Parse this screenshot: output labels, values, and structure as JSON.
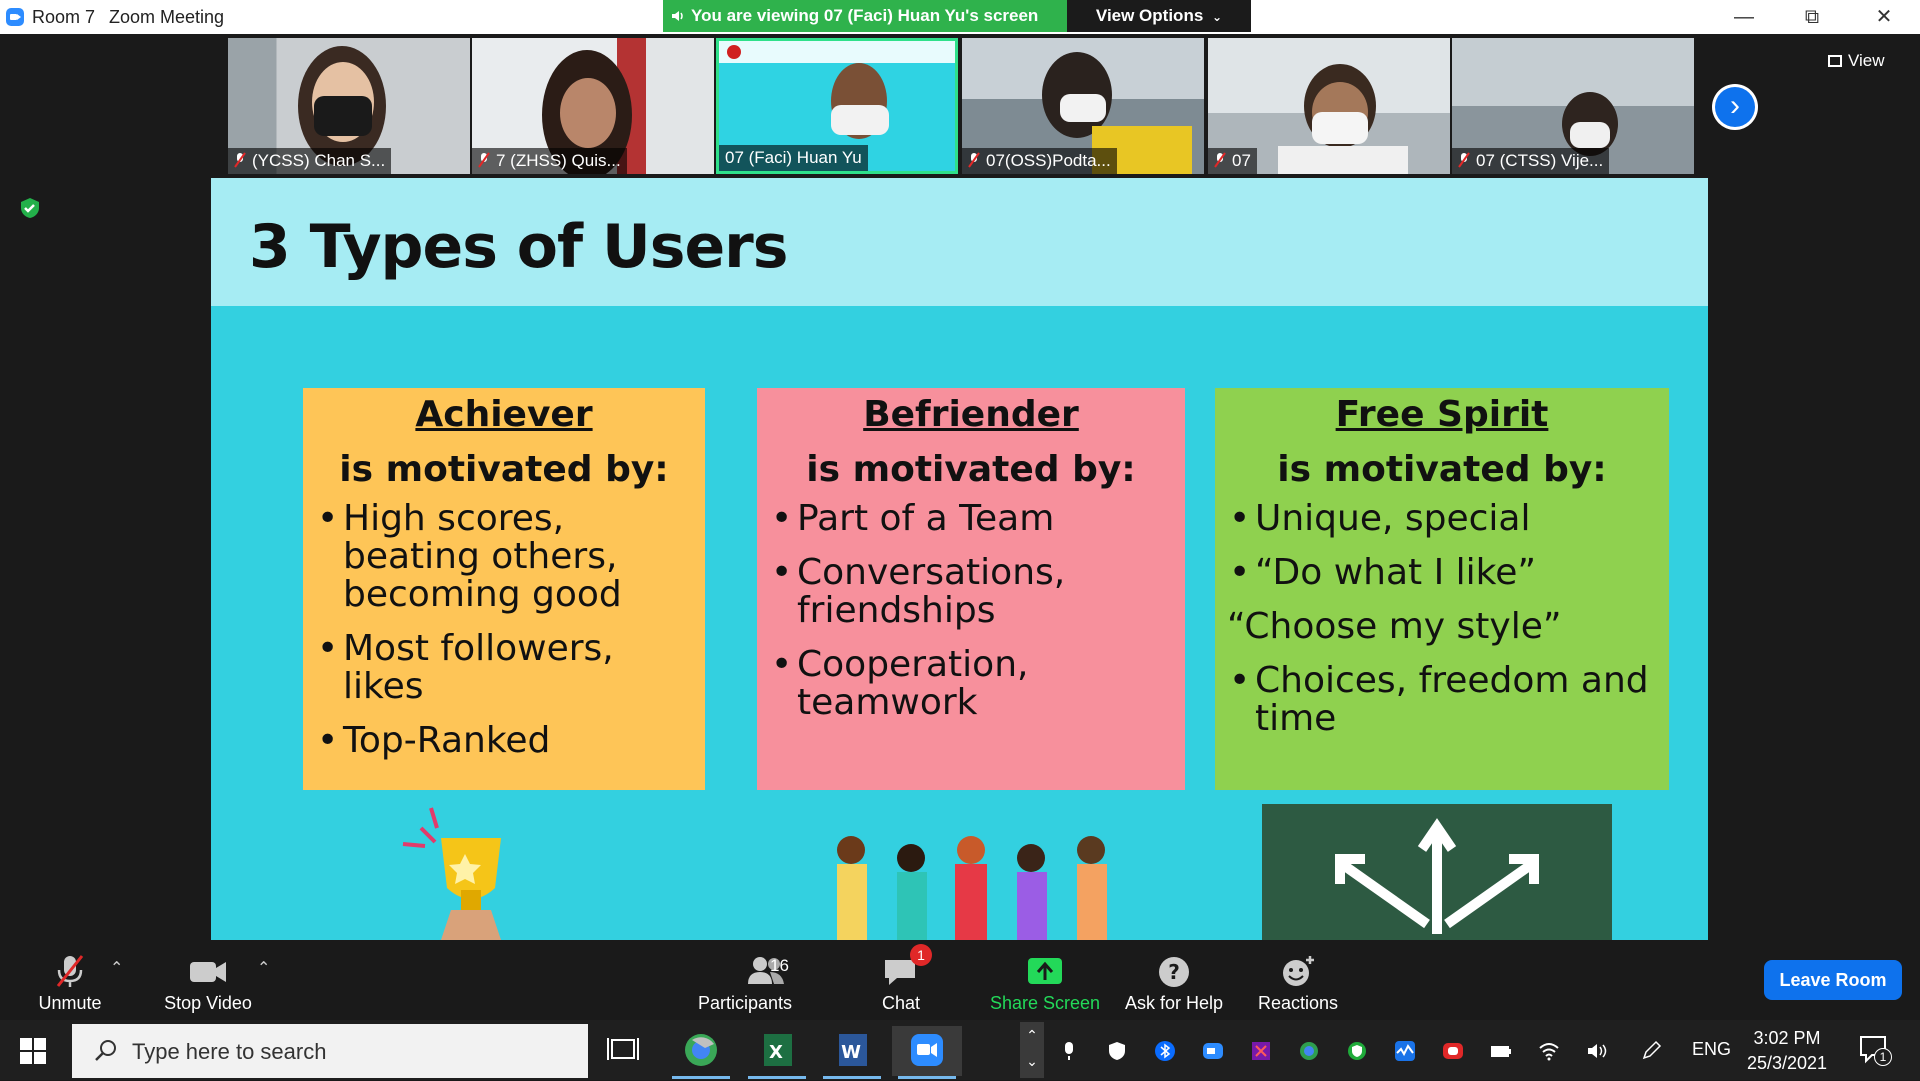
{
  "titlebar": {
    "room": "Room 7",
    "app": "Zoom Meeting",
    "banner": "You are viewing 07 (Faci) Huan Yu's screen",
    "view_options": "View Options",
    "view_options_icon": "chevron-down-icon"
  },
  "thumbnails": [
    {
      "name": "(YCSS) Chan S...",
      "muted": true
    },
    {
      "name": "7 (ZHSS) Quis...",
      "muted": true
    },
    {
      "name": "07 (Faci) Huan Yu",
      "muted": false,
      "active": true
    },
    {
      "name": "07(OSS)Podta...",
      "muted": true
    },
    {
      "name": "07",
      "muted": true
    },
    {
      "name": "07 (CTSS) Vije...",
      "muted": true
    }
  ],
  "view_button": "View",
  "slide": {
    "title": "3 Types of Users",
    "cards": [
      {
        "heading": "Achiever",
        "sub": "is motivated by:",
        "items": [
          "High scores, beating others, becoming good",
          "Most followers, likes",
          "Top-Ranked"
        ]
      },
      {
        "heading": "Befriender",
        "sub": "is motivated by:",
        "items": [
          "Part of a Team",
          "Conversations, friendships",
          "Cooperation, teamwork"
        ]
      },
      {
        "heading": "Free Spirit",
        "sub": "is motivated by:",
        "items": [
          "Unique, special",
          "“Do what I like”",
          "“Choose my style”",
          "Choices, freedom and time"
        ]
      }
    ]
  },
  "toolbar": {
    "unmute": "Unmute",
    "stop_video": "Stop Video",
    "participants": "Participants",
    "participants_count": "16",
    "chat": "Chat",
    "chat_badge": "1",
    "share_screen": "Share Screen",
    "ask_help": "Ask for Help",
    "reactions": "Reactions",
    "leave": "Leave Room"
  },
  "taskbar": {
    "search_placeholder": "Type here to search",
    "lang": "ENG",
    "time": "3:02 PM",
    "date": "25/3/2021",
    "notif_count": "1"
  },
  "colors": {
    "banner_green": "#2fb24c",
    "slide_bg": "#33d0e0",
    "achiever": "#fec557",
    "befriender": "#f7909c",
    "free_spirit": "#8fd14f",
    "share_green": "#23d959",
    "leave_blue": "#0e72ed"
  }
}
